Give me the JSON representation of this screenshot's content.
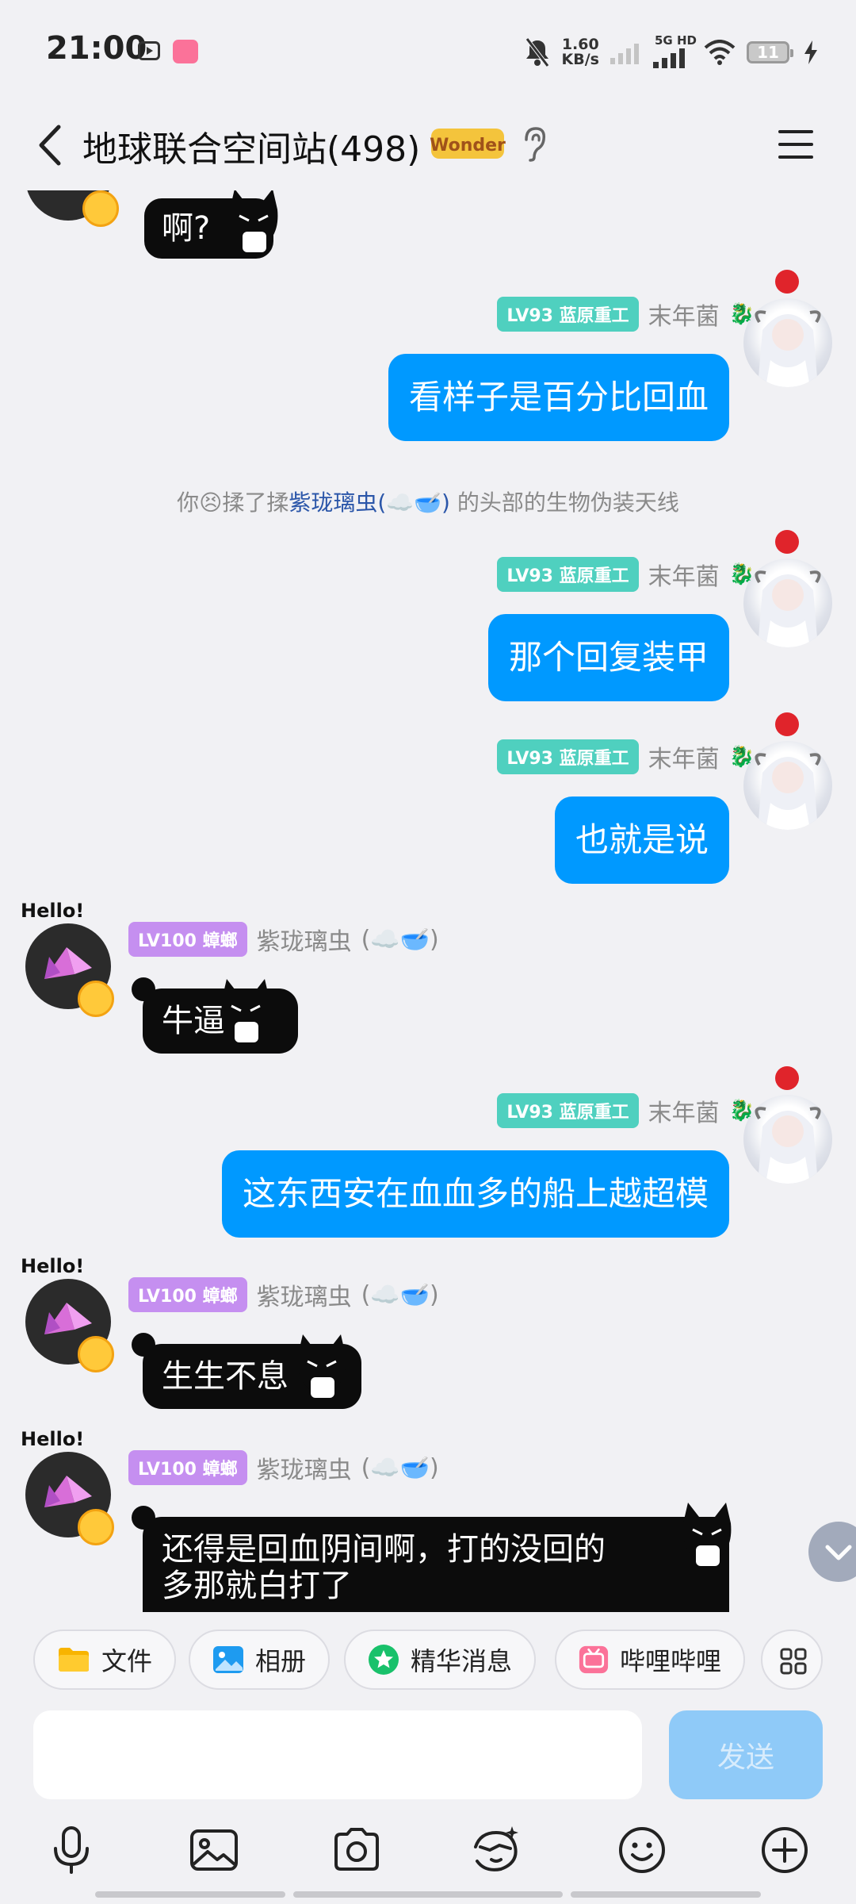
{
  "status_bar": {
    "time": "21:00",
    "speed_value": "1.60",
    "speed_unit": "KB/s",
    "network": "5G HD",
    "battery": "11"
  },
  "header": {
    "title": "地球联合空间站(498)",
    "badge_text": "Wonder"
  },
  "messages": [
    {
      "type": "sticker",
      "text": "啊?"
    },
    {
      "type": "self",
      "level": "LV93 蓝原重工",
      "name": "末年菌",
      "text": "看样子是百分比回血"
    },
    {
      "type": "system",
      "prefix": "你",
      "action": "揉了揉",
      "target": "紫珑璃虫",
      "target_emoji": "(☁️🥣)",
      "suffix": "的头部的生物伪装天线"
    },
    {
      "type": "self",
      "level": "LV93 蓝原重工",
      "name": "末年菌",
      "text": "那个回复装甲"
    },
    {
      "type": "self",
      "level": "LV93 蓝原重工",
      "name": "末年菌",
      "text": "也就是说"
    },
    {
      "type": "other",
      "avatar_label": "Hello!",
      "level": "LV100 蟑螂",
      "name": "紫珑璃虫",
      "name_suffix": "(☁️🥣)",
      "text": "牛逼"
    },
    {
      "type": "self",
      "level": "LV93 蓝原重工",
      "name": "末年菌",
      "text": "这东西安在血血多的船上越超模"
    },
    {
      "type": "other",
      "avatar_label": "Hello!",
      "level": "LV100 蟑螂",
      "name": "紫珑璃虫",
      "name_suffix": "(☁️🥣)",
      "text": "生生不息"
    },
    {
      "type": "other",
      "avatar_label": "Hello!",
      "level": "LV100 蟑螂",
      "name": "紫珑璃虫",
      "name_suffix": "(☁️🥣)",
      "text_line1": "还得是回血阴间啊，打的没回的",
      "text_line2": "多那就白打了"
    }
  ],
  "quick_actions": [
    {
      "label": "文件",
      "icon": "folder-icon"
    },
    {
      "label": "相册",
      "icon": "photo-icon"
    },
    {
      "label": "精华消息",
      "icon": "star-icon"
    },
    {
      "label": "哔哩哔哩",
      "icon": "bilibili-icon"
    }
  ],
  "input": {
    "placeholder": "",
    "send_label": "发送"
  },
  "toolbar": [
    "mic-icon",
    "image-icon",
    "camera-icon",
    "emoji-face-icon",
    "smiley-icon",
    "plus-icon"
  ],
  "colors": {
    "bubble_self": "#0099ff",
    "level_self": "#4fd0bf",
    "level_other": "#c58ff0",
    "send_disabled": "#8fcaf8"
  }
}
